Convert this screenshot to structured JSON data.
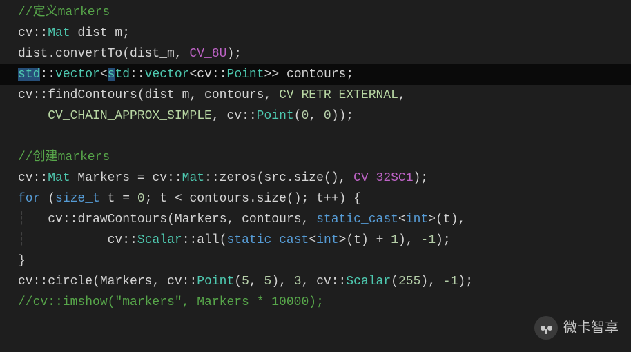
{
  "lines": {
    "l1_comment": "//定义markers",
    "l2_cv": "cv",
    "l2_mat": "Mat",
    "l2_var": " dist_m;",
    "l3_text": "dist.convertTo(dist_m, ",
    "l3_macro": "CV_8U",
    "l3_end": ");",
    "l4_std1": "std",
    "l4_colon": "::",
    "l4_vector": "vector",
    "l4_lt": "<",
    "l4_std2_s": "s",
    "l4_std2_td": "td",
    "l4_vector2": "vector",
    "l4_lt2": "<",
    "l4_cv": "cv",
    "l4_point": "Point",
    "l4_gtgt": ">>",
    "l4_rest": " contours;",
    "l5_cv": "cv",
    "l5_func": "findContours(dist_m, contours, ",
    "l5_macro": "CV_RETR_EXTERNAL",
    "l5_comma": ",",
    "l6_indent": "    ",
    "l6_macro": "CV_CHAIN_APPROX_SIMPLE",
    "l6_mid": ", cv::",
    "l6_point": "Point",
    "l6_paren": "(",
    "l6_z1": "0",
    "l6_comma": ", ",
    "l6_z2": "0",
    "l6_end": "));",
    "l8_comment": "//创建markers",
    "l9_cv": "cv",
    "l9_mat": "Mat",
    "l9_eq": " Markers = cv::",
    "l9_mat2": "Mat",
    "l9_zeros": "::zeros(src.size(), ",
    "l9_macro": "CV_32SC1",
    "l9_end": ");",
    "l10_for": "for",
    "l10_open": " (",
    "l10_sizet": "size_t",
    "l10_mid": " t = ",
    "l10_zero": "0",
    "l10_rest": "; t < contours.size(); t++) {",
    "l11_indent": "    ",
    "l11_cv": "cv",
    "l11_func": "::drawContours(Markers, contours, ",
    "l11_cast": "static_cast",
    "l11_lt": "<",
    "l11_int": "int",
    "l11_gt": ">",
    "l11_end": "(t),",
    "l12_indent": "            ",
    "l12_cv": "cv::",
    "l12_scalar": "Scalar",
    "l12_all": "::all(",
    "l12_cast": "static_cast",
    "l12_lt": "<",
    "l12_int": "int",
    "l12_gt": ">",
    "l12_mid": "(t) + ",
    "l12_one": "1",
    "l12_c2": "), ",
    "l12_neg1": "-1",
    "l12_end": ");",
    "l13_brace": "}",
    "l14_cv": "cv",
    "l14_circ": "::circle(Markers, cv::",
    "l14_point": "Point",
    "l14_open": "(",
    "l14_n5a": "5",
    "l14_c1": ", ",
    "l14_n5b": "5",
    "l14_c2": "), ",
    "l14_n3": "3",
    "l14_c3": ", cv::",
    "l14_scalar": "Scalar",
    "l14_open2": "(",
    "l14_255": "255",
    "l14_c4": "), ",
    "l14_neg1": "-1",
    "l14_end": ");",
    "l15_comment": "//cv::imshow(\"markers\", Markers * 10000);"
  },
  "watermark": "微卡智享"
}
